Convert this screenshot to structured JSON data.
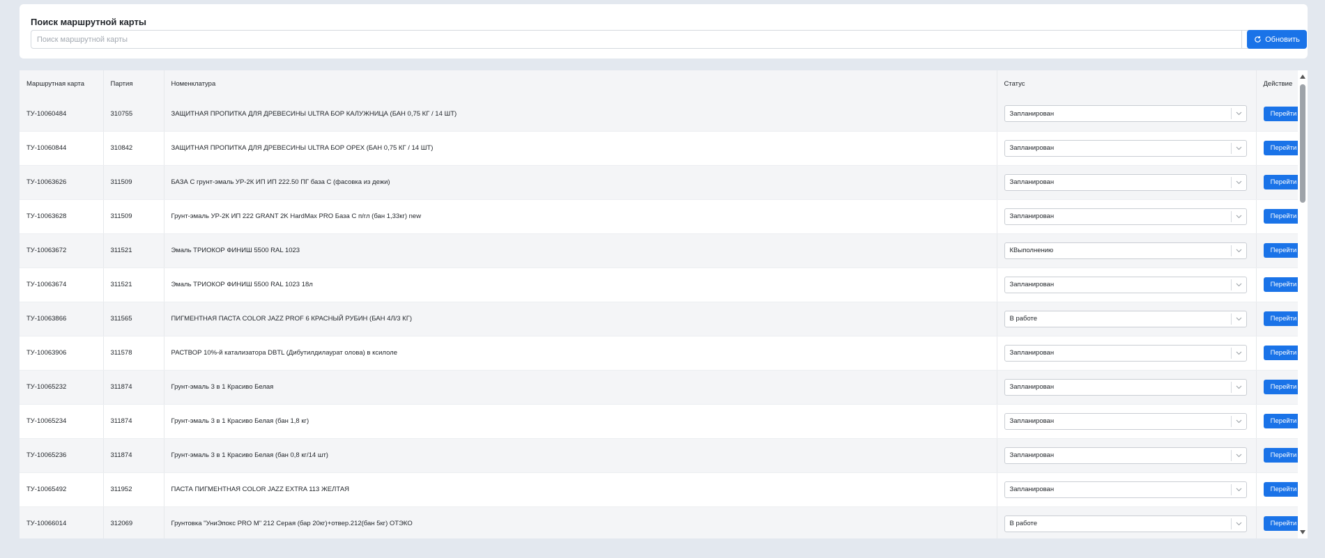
{
  "search": {
    "title": "Поиск маршрутной карты",
    "placeholder": "Поиск маршрутной карты",
    "value": "",
    "refresh_label": "Обновить"
  },
  "table": {
    "columns": [
      "Маршрутная карта",
      "Партия",
      "Номенклатура",
      "Статус",
      "Действие"
    ],
    "action_label": "Перейти",
    "rows": [
      {
        "card": "ТУ-10060484",
        "batch": "310755",
        "item": "ЗАЩИТНАЯ ПРОПИТКА ДЛЯ ДРЕВЕСИНЫ ULTRA БОР КАЛУЖНИЦА (БАН 0,75 КГ / 14 ШТ)",
        "status": "Запланирован"
      },
      {
        "card": "ТУ-10060844",
        "batch": "310842",
        "item": "ЗАЩИТНАЯ ПРОПИТКА ДЛЯ ДРЕВЕСИНЫ ULTRA БОР ОРЕХ (БАН 0,75 КГ / 14 ШТ)",
        "status": "Запланирован"
      },
      {
        "card": "ТУ-10063626",
        "batch": "311509",
        "item": "БАЗА С грунт-эмаль УР-2К ИП ИП 222.50 ПГ база С (фасовка из дежи)",
        "status": "Запланирован"
      },
      {
        "card": "ТУ-10063628",
        "batch": "311509",
        "item": "Грунт-эмаль УР-2К ИП 222 GRANT 2K HardMax PRO База С п/гл (бан 1,33кг) new",
        "status": "Запланирован"
      },
      {
        "card": "ТУ-10063672",
        "batch": "311521",
        "item": "Эмаль ТРИОКОР ФИНИШ 5500 RAL 1023",
        "status": "КВыполнению"
      },
      {
        "card": "ТУ-10063674",
        "batch": "311521",
        "item": "Эмаль ТРИОКОР ФИНИШ 5500 RAL 1023 18л",
        "status": "Запланирован"
      },
      {
        "card": "ТУ-10063866",
        "batch": "311565",
        "item": "ПИГМЕНТНАЯ ПАСТА COLOR JAZZ PROF 6 КРАСНЫЙ РУБИН (БАН 4Л/3 КГ)",
        "status": "В работе"
      },
      {
        "card": "ТУ-10063906",
        "batch": "311578",
        "item": "РАСТВОР 10%-й катализатора DBTL (Дибутилдилаурат олова) в ксилоле",
        "status": "Запланирован"
      },
      {
        "card": "ТУ-10065232",
        "batch": "311874",
        "item": "Грунт-эмаль 3 в 1 Красиво Белая",
        "status": "Запланирован"
      },
      {
        "card": "ТУ-10065234",
        "batch": "311874",
        "item": "Грунт-эмаль 3 в 1 Красиво Белая (бан 1,8 кг)",
        "status": "Запланирован"
      },
      {
        "card": "ТУ-10065236",
        "batch": "311874",
        "item": "Грунт-эмаль 3 в 1 Красиво Белая (бан 0,8 кг/14 шт)",
        "status": "Запланирован"
      },
      {
        "card": "ТУ-10065492",
        "batch": "311952",
        "item": "ПАСТА ПИГМЕНТНАЯ COLOR JAZZ EXTRA 113 ЖЕЛТАЯ",
        "status": "Запланирован"
      },
      {
        "card": "ТУ-10066014",
        "batch": "312069",
        "item": "Грунтовка \"УниЭпокс PRO M\" 212 Серая (бар 20кг)+отвер.212(бан 5кг) ОТЭКО",
        "status": "В работе"
      }
    ]
  },
  "colors": {
    "accent": "#1a73e8",
    "background": "#e3e8ef"
  },
  "icons": {
    "search": "search-icon",
    "refresh": "refresh-icon",
    "dropdown": "chevron-down-icon"
  }
}
